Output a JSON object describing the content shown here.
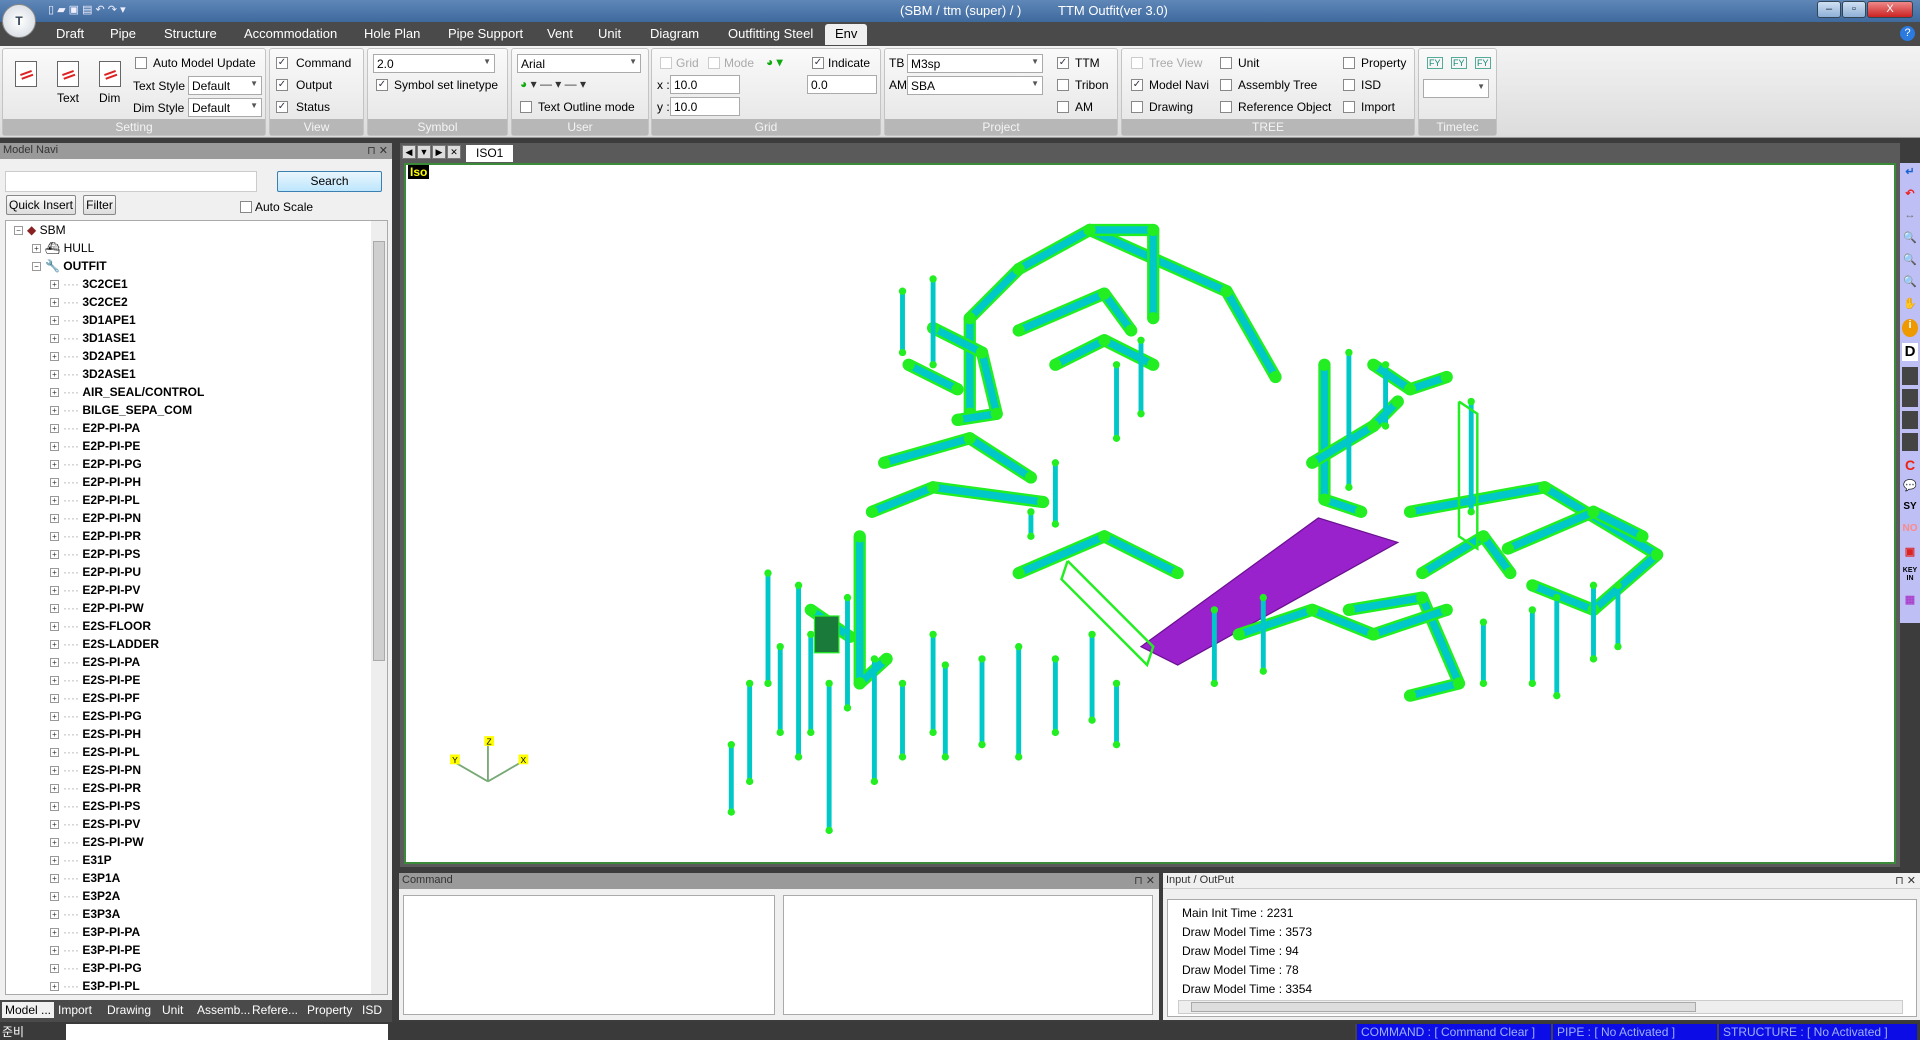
{
  "window": {
    "title_left": "(SBM / ttm (super) / )",
    "title_right": "TTM Outfit(ver 3.0)",
    "logo": "T",
    "help_icon": "help-icon"
  },
  "menu": {
    "tabs": [
      "Draft",
      "Pipe",
      "Structure",
      "Accommodation",
      "Hole Plan",
      "Pipe Support",
      "Vent",
      "Unit",
      "Diagram",
      "Outfitting Steel",
      "Env"
    ],
    "active": "Env"
  },
  "ribbon": {
    "setting": {
      "label": "Setting",
      "text_btn": "Text",
      "dim_btn": "Dim",
      "auto_model_update": "Auto Model Update",
      "text_style_label": "Text Style",
      "text_style": "Default",
      "dim_style_label": "Dim Style",
      "dim_style": "Default"
    },
    "view": {
      "label": "View",
      "command": "Command",
      "output": "Output",
      "status": "Status"
    },
    "symbol": {
      "label": "Symbol",
      "size": "2.0",
      "symbol_set_linetype": "Symbol set linetype"
    },
    "user": {
      "label": "User",
      "font": "Arial",
      "text_outline_mode": "Text Outline mode"
    },
    "grid": {
      "label": "Grid",
      "grid": "Grid",
      "mode": "Mode",
      "indicate": "Indicate",
      "x_label": "x :",
      "x": "10.0",
      "y_label": "y :",
      "y": "10.0",
      "indicate_value": "0.0"
    },
    "project": {
      "label": "Project",
      "tb_label": "TB",
      "tb": "M3sp",
      "am_label": "AM",
      "am": "SBA",
      "ttm": "TTM",
      "tribon": "Tribon",
      "am_check": "AM"
    },
    "tree": {
      "label": "TREE",
      "tree_view": "Tree View",
      "model_navi": "Model Navi",
      "drawing": "Drawing",
      "unit": "Unit",
      "assembly_tree": "Assembly Tree",
      "reference_object": "Reference Object",
      "property": "Property",
      "isd": "ISD",
      "import": "Import"
    },
    "timetec": {
      "label": "Timetec",
      "icon_text": "FY"
    }
  },
  "model_navi": {
    "title": "Model Navi",
    "search_value": "",
    "search_btn": "Search",
    "quick_insert": "Quick Insert",
    "filter": "Filter",
    "auto_scale": "Auto Scale",
    "root": "SBM",
    "hull": "HULL",
    "outfit": "OUTFIT",
    "items": [
      "3C2CE1",
      "3C2CE2",
      "3D1APE1",
      "3D1ASE1",
      "3D2APE1",
      "3D2ASE1",
      "AIR_SEAL/CONTROL",
      "BILGE_SEPA_COM",
      "E2P-PI-PA",
      "E2P-PI-PE",
      "E2P-PI-PG",
      "E2P-PI-PH",
      "E2P-PI-PL",
      "E2P-PI-PN",
      "E2P-PI-PR",
      "E2P-PI-PS",
      "E2P-PI-PU",
      "E2P-PI-PV",
      "E2P-PI-PW",
      "E2S-FLOOR",
      "E2S-LADDER",
      "E2S-PI-PA",
      "E2S-PI-PE",
      "E2S-PI-PF",
      "E2S-PI-PG",
      "E2S-PI-PH",
      "E2S-PI-PL",
      "E2S-PI-PN",
      "E2S-PI-PR",
      "E2S-PI-PS",
      "E2S-PI-PV",
      "E2S-PI-PW",
      "E31P",
      "E3P1A",
      "E3P2A",
      "E3P3A",
      "E3P-PI-PA",
      "E3P-PI-PE",
      "E3P-PI-PG",
      "E3P-PI-PL"
    ]
  },
  "bottom_tabs": [
    "Model ...",
    "Import",
    "Drawing",
    "Unit",
    "Assemb...",
    "Refere...",
    "Property",
    "ISD"
  ],
  "viewport": {
    "tab": "ISO1",
    "view_label": "Iso",
    "axis_labels": [
      "Z",
      "Y",
      "X"
    ],
    "colors": {
      "pipe": "#00c8c8",
      "fitting": "#22ee22",
      "deck": "#9a22cc"
    }
  },
  "right_toolbar": [
    "enter-icon",
    "undo-icon",
    "move-icon",
    "zoom-in-icon",
    "zoom-out-icon",
    "zoom-all-icon",
    "pan-hand-icon",
    "info-icon",
    "d-icon",
    "view1-icon",
    "view2-icon",
    "view3-icon",
    "view4-icon",
    "c-icon",
    "comment-icon",
    "sy-icon",
    "no-icon",
    "target-icon",
    "key-in-icon",
    "grid-icon"
  ],
  "right_toolbar_text": {
    "d": "D",
    "c": "C",
    "sy": "SY",
    "no": "NO",
    "keyin": "KEY IN",
    "info": "i"
  },
  "command_panel": {
    "title": "Command"
  },
  "io_panel": {
    "title": "Input / OutPut",
    "lines": [
      "Main Init Time : 2231",
      "Draw Model Time : 3573",
      "Draw Model Time : 94",
      "Draw Model Time : 78",
      "Draw Model Time : 3354"
    ]
  },
  "status": {
    "ready": "준비",
    "command": "COMMAND : [ Command Clear ]",
    "pipe": "PIPE : [ No Activated ]",
    "structure": "STRUCTURE : [ No Activated ]"
  }
}
